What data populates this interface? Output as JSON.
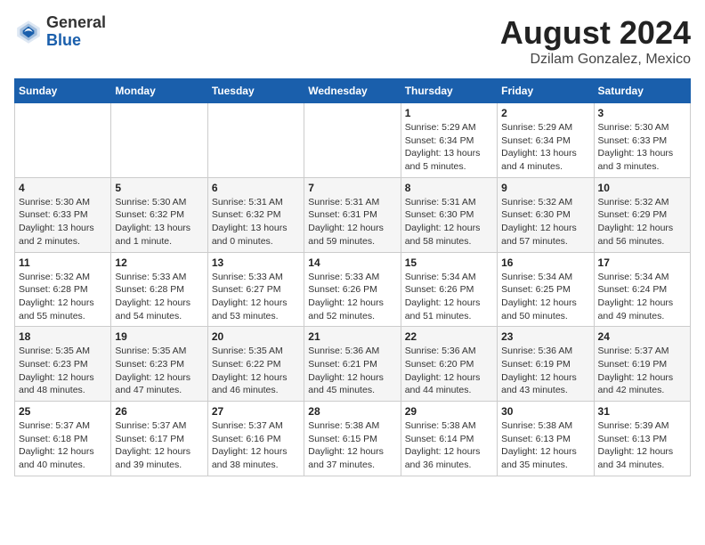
{
  "logo": {
    "general": "General",
    "blue": "Blue"
  },
  "header": {
    "month_year": "August 2024",
    "location": "Dzilam Gonzalez, Mexico"
  },
  "weekdays": [
    "Sunday",
    "Monday",
    "Tuesday",
    "Wednesday",
    "Thursday",
    "Friday",
    "Saturday"
  ],
  "weeks": [
    [
      {
        "day": "",
        "info": ""
      },
      {
        "day": "",
        "info": ""
      },
      {
        "day": "",
        "info": ""
      },
      {
        "day": "",
        "info": ""
      },
      {
        "day": "1",
        "info": "Sunrise: 5:29 AM\nSunset: 6:34 PM\nDaylight: 13 hours\nand 5 minutes."
      },
      {
        "day": "2",
        "info": "Sunrise: 5:29 AM\nSunset: 6:34 PM\nDaylight: 13 hours\nand 4 minutes."
      },
      {
        "day": "3",
        "info": "Sunrise: 5:30 AM\nSunset: 6:33 PM\nDaylight: 13 hours\nand 3 minutes."
      }
    ],
    [
      {
        "day": "4",
        "info": "Sunrise: 5:30 AM\nSunset: 6:33 PM\nDaylight: 13 hours\nand 2 minutes."
      },
      {
        "day": "5",
        "info": "Sunrise: 5:30 AM\nSunset: 6:32 PM\nDaylight: 13 hours\nand 1 minute."
      },
      {
        "day": "6",
        "info": "Sunrise: 5:31 AM\nSunset: 6:32 PM\nDaylight: 13 hours\nand 0 minutes."
      },
      {
        "day": "7",
        "info": "Sunrise: 5:31 AM\nSunset: 6:31 PM\nDaylight: 12 hours\nand 59 minutes."
      },
      {
        "day": "8",
        "info": "Sunrise: 5:31 AM\nSunset: 6:30 PM\nDaylight: 12 hours\nand 58 minutes."
      },
      {
        "day": "9",
        "info": "Sunrise: 5:32 AM\nSunset: 6:30 PM\nDaylight: 12 hours\nand 57 minutes."
      },
      {
        "day": "10",
        "info": "Sunrise: 5:32 AM\nSunset: 6:29 PM\nDaylight: 12 hours\nand 56 minutes."
      }
    ],
    [
      {
        "day": "11",
        "info": "Sunrise: 5:32 AM\nSunset: 6:28 PM\nDaylight: 12 hours\nand 55 minutes."
      },
      {
        "day": "12",
        "info": "Sunrise: 5:33 AM\nSunset: 6:28 PM\nDaylight: 12 hours\nand 54 minutes."
      },
      {
        "day": "13",
        "info": "Sunrise: 5:33 AM\nSunset: 6:27 PM\nDaylight: 12 hours\nand 53 minutes."
      },
      {
        "day": "14",
        "info": "Sunrise: 5:33 AM\nSunset: 6:26 PM\nDaylight: 12 hours\nand 52 minutes."
      },
      {
        "day": "15",
        "info": "Sunrise: 5:34 AM\nSunset: 6:26 PM\nDaylight: 12 hours\nand 51 minutes."
      },
      {
        "day": "16",
        "info": "Sunrise: 5:34 AM\nSunset: 6:25 PM\nDaylight: 12 hours\nand 50 minutes."
      },
      {
        "day": "17",
        "info": "Sunrise: 5:34 AM\nSunset: 6:24 PM\nDaylight: 12 hours\nand 49 minutes."
      }
    ],
    [
      {
        "day": "18",
        "info": "Sunrise: 5:35 AM\nSunset: 6:23 PM\nDaylight: 12 hours\nand 48 minutes."
      },
      {
        "day": "19",
        "info": "Sunrise: 5:35 AM\nSunset: 6:23 PM\nDaylight: 12 hours\nand 47 minutes."
      },
      {
        "day": "20",
        "info": "Sunrise: 5:35 AM\nSunset: 6:22 PM\nDaylight: 12 hours\nand 46 minutes."
      },
      {
        "day": "21",
        "info": "Sunrise: 5:36 AM\nSunset: 6:21 PM\nDaylight: 12 hours\nand 45 minutes."
      },
      {
        "day": "22",
        "info": "Sunrise: 5:36 AM\nSunset: 6:20 PM\nDaylight: 12 hours\nand 44 minutes."
      },
      {
        "day": "23",
        "info": "Sunrise: 5:36 AM\nSunset: 6:19 PM\nDaylight: 12 hours\nand 43 minutes."
      },
      {
        "day": "24",
        "info": "Sunrise: 5:37 AM\nSunset: 6:19 PM\nDaylight: 12 hours\nand 42 minutes."
      }
    ],
    [
      {
        "day": "25",
        "info": "Sunrise: 5:37 AM\nSunset: 6:18 PM\nDaylight: 12 hours\nand 40 minutes."
      },
      {
        "day": "26",
        "info": "Sunrise: 5:37 AM\nSunset: 6:17 PM\nDaylight: 12 hours\nand 39 minutes."
      },
      {
        "day": "27",
        "info": "Sunrise: 5:37 AM\nSunset: 6:16 PM\nDaylight: 12 hours\nand 38 minutes."
      },
      {
        "day": "28",
        "info": "Sunrise: 5:38 AM\nSunset: 6:15 PM\nDaylight: 12 hours\nand 37 minutes."
      },
      {
        "day": "29",
        "info": "Sunrise: 5:38 AM\nSunset: 6:14 PM\nDaylight: 12 hours\nand 36 minutes."
      },
      {
        "day": "30",
        "info": "Sunrise: 5:38 AM\nSunset: 6:13 PM\nDaylight: 12 hours\nand 35 minutes."
      },
      {
        "day": "31",
        "info": "Sunrise: 5:39 AM\nSunset: 6:13 PM\nDaylight: 12 hours\nand 34 minutes."
      }
    ]
  ]
}
